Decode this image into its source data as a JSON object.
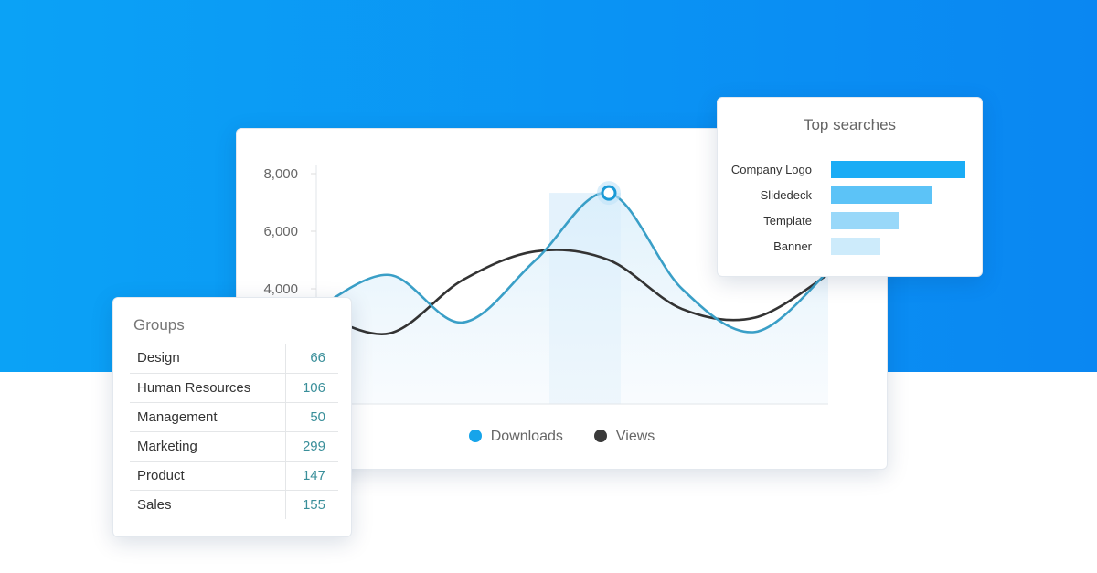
{
  "chart_data": [
    {
      "type": "line",
      "yticks": [
        "8,000",
        "6,000",
        "4,000"
      ],
      "ylim": [
        0,
        8500
      ],
      "grid": false,
      "legend_position": "bottom",
      "series": [
        {
          "name": "Downloads",
          "color": "#3a9fc7",
          "values": [
            3300,
            4480,
            2830,
            5000,
            7330,
            4000,
            2500,
            4600
          ]
        },
        {
          "name": "Views",
          "color": "#333333",
          "values": [
            3200,
            2450,
            4300,
            5300,
            5000,
            3300,
            3000,
            4500
          ]
        }
      ],
      "highlight": {
        "series": "Downloads",
        "index": 4
      }
    },
    {
      "type": "bar",
      "title": "Top searches",
      "orientation": "horizontal",
      "categories": [
        "Company Logo",
        "Slidedeck",
        "Template",
        "Banner"
      ],
      "values": [
        100,
        75,
        50,
        37
      ],
      "colors": [
        "#1aacf5",
        "#5cc3f7",
        "#99d8f9",
        "#cdebfb"
      ]
    },
    {
      "type": "table",
      "title": "Groups",
      "rows": [
        [
          "Design",
          "66"
        ],
        [
          "Human Resources",
          "106"
        ],
        [
          "Management",
          "50"
        ],
        [
          "Marketing",
          "299"
        ],
        [
          "Product",
          "147"
        ],
        [
          "Sales",
          "155"
        ]
      ]
    }
  ]
}
